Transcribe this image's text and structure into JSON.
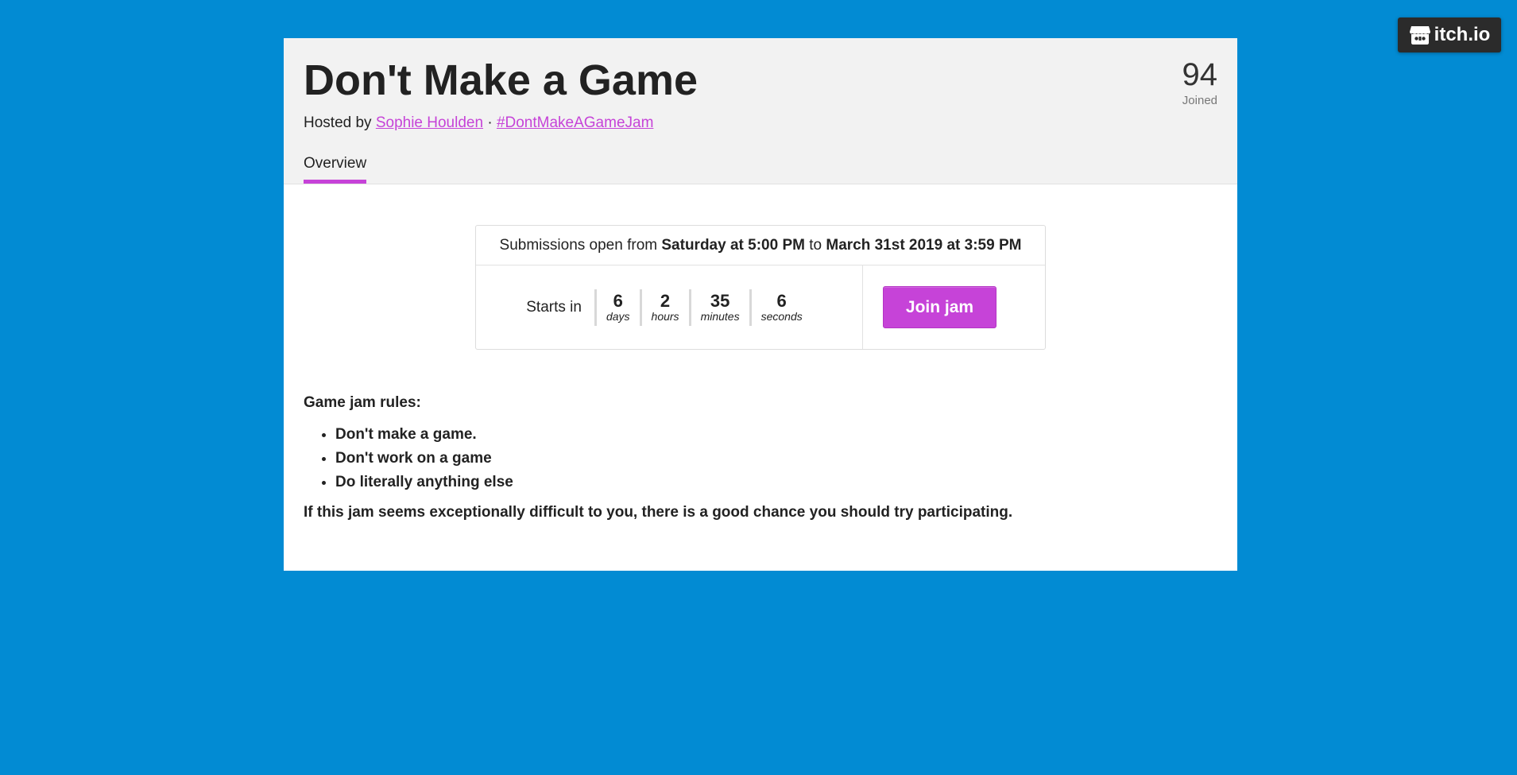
{
  "brand": {
    "name": "itch.io",
    "icon": "itchio-logo-icon"
  },
  "jam": {
    "title": "Don't Make a Game",
    "hosted_by_prefix": "Hosted by",
    "host_name": "Sophie Houlden",
    "separator": "·",
    "hashtag": "#DontMakeAGameJam",
    "joined_count": "94",
    "joined_label": "Joined"
  },
  "tabs": [
    {
      "label": "Overview",
      "active": true
    }
  ],
  "submissions": {
    "prefix": "Submissions open from",
    "start": "Saturday at 5:00 PM",
    "middle": "to",
    "end": "March 31st 2019 at 3:59 PM"
  },
  "countdown": {
    "label": "Starts in",
    "units": [
      {
        "value": "6",
        "unit": "days"
      },
      {
        "value": "2",
        "unit": "hours"
      },
      {
        "value": "35",
        "unit": "minutes"
      },
      {
        "value": "6",
        "unit": "seconds"
      }
    ]
  },
  "join_button": "Join jam",
  "rules": {
    "heading": "Game jam rules:",
    "items": [
      "Don't make a game.",
      "Don't work on a game",
      "Do literally anything else"
    ],
    "footer": "If this jam seems exceptionally difficult to you, there is a good chance you should try participating."
  },
  "colors": {
    "background": "#028bd3",
    "accent": "#c643d8",
    "header_bg": "#f2f2f2",
    "badge_bg": "#2b2b2b"
  }
}
